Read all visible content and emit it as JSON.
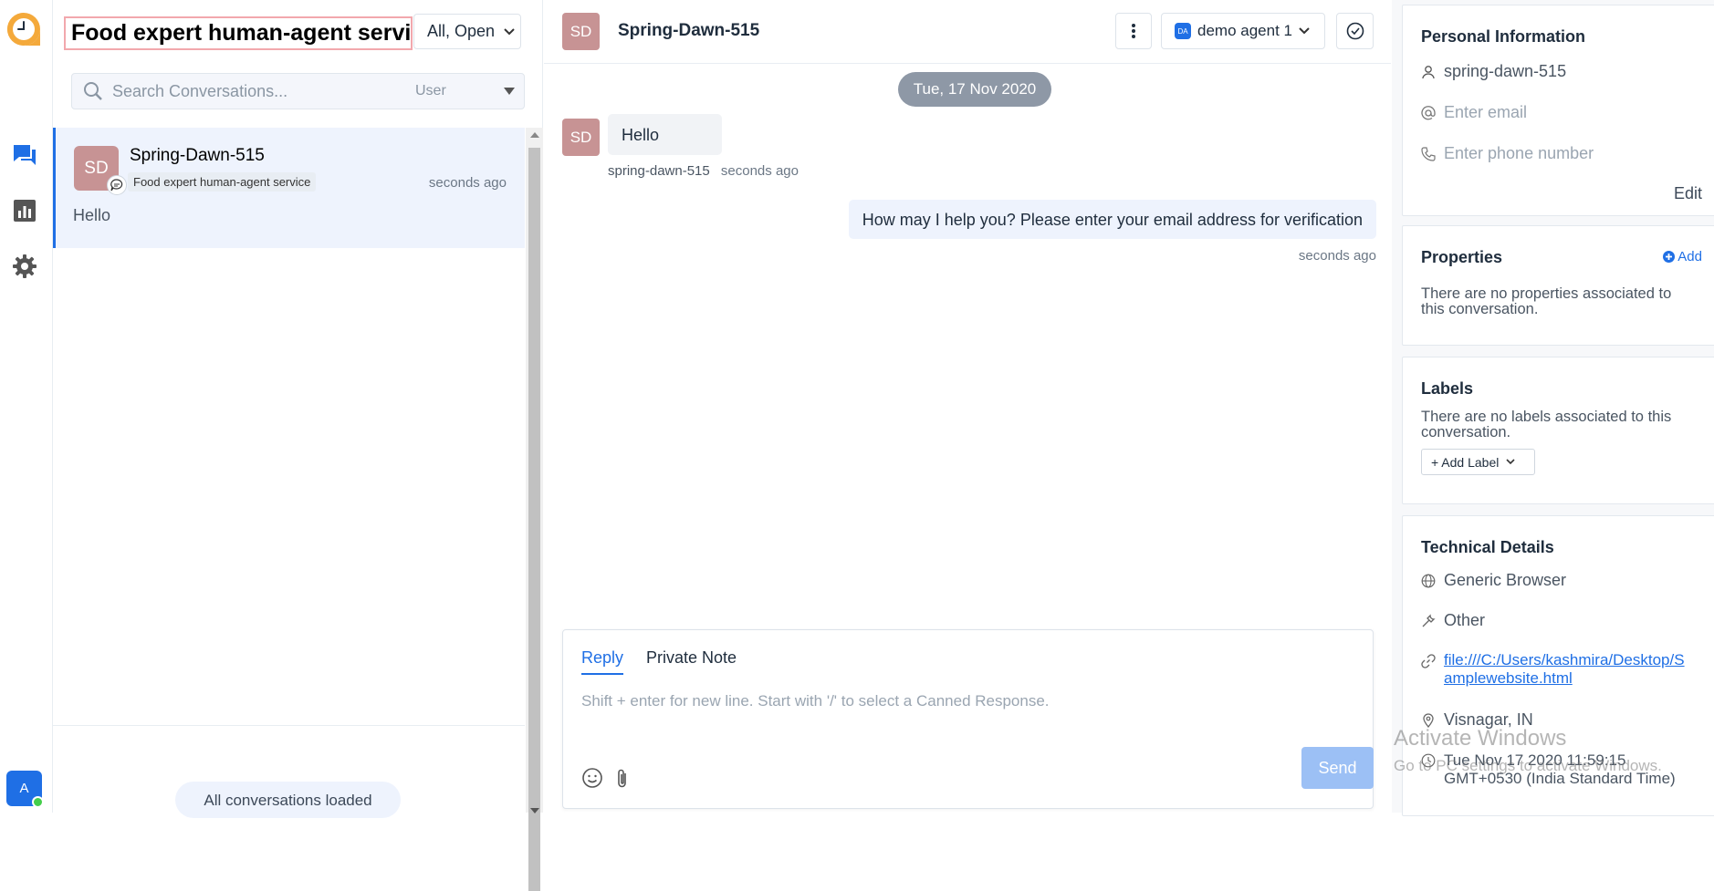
{
  "sidebar_nav": {
    "items": [
      {
        "icon": "conversations-icon",
        "active": true
      },
      {
        "icon": "reports-icon",
        "active": false
      },
      {
        "icon": "settings-icon",
        "active": false
      }
    ],
    "user_initial": "A"
  },
  "list": {
    "inbox_title": "Food expert human-agent service",
    "status_filter": "All, Open",
    "search": {
      "placeholder": "Search Conversations...",
      "scope": "User"
    },
    "conversations": [
      {
        "initials": "SD",
        "name": "Spring-Dawn-515",
        "inbox": "Food expert human-agent service",
        "time": "seconds ago",
        "preview": "Hello"
      }
    ],
    "footer": "All conversations loaded"
  },
  "chat": {
    "header": {
      "initials": "SD",
      "name": "Spring-Dawn-515",
      "agent_initials": "DA",
      "agent_name": "demo agent 1"
    },
    "date_divider": "Tue, 17 Nov 2020",
    "messages": [
      {
        "direction": "incoming",
        "initials": "SD",
        "text": "Hello",
        "sender": "spring-dawn-515",
        "time": "seconds ago"
      },
      {
        "direction": "outgoing",
        "text": "How may I help you? Please enter your email address for verification",
        "time": "seconds ago"
      }
    ],
    "composer": {
      "tabs": [
        "Reply",
        "Private Note"
      ],
      "active_tab": "Reply",
      "placeholder": "Shift + enter for new line. Start with '/' to select a Canned Response.",
      "send_label": "Send"
    }
  },
  "contact_panel": {
    "personal": {
      "title": "Personal Information",
      "name": "spring-dawn-515",
      "email_placeholder": "Enter email",
      "phone_placeholder": "Enter phone number",
      "edit_label": "Edit"
    },
    "properties": {
      "title": "Properties",
      "add_label": "Add",
      "empty": "There are no properties associated to this conversation."
    },
    "labels": {
      "title": "Labels",
      "empty": "There are no labels associated to this conversation.",
      "add_label": "+ Add Label"
    },
    "technical": {
      "title": "Technical Details",
      "browser": "Generic Browser",
      "os": "Other",
      "url_line1": "file:///C:/Users/kashmira/Desktop/S",
      "url_line2": "amplewebsite.html",
      "location": "Visnagar, IN",
      "time_line1": "Tue Nov 17 2020 11:59:15",
      "time_line2": "GMT+0530 (India Standard Time)"
    }
  },
  "watermark": {
    "line1": "Activate Windows",
    "line2": "Go to PC settings to activate Windows."
  },
  "colors": {
    "accent": "#1f6fe5",
    "avatar": "#c79394",
    "date_pill": "#8e98a6",
    "send_disabled": "#9cc0f5",
    "title_outline": "#f2a8ad"
  }
}
